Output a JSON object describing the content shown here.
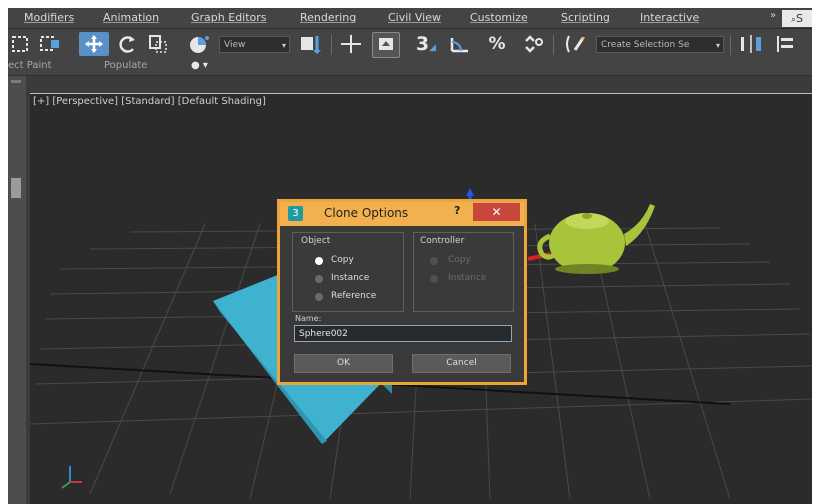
{
  "menu": {
    "items": [
      "Modifiers",
      "Animation",
      "Graph Editors",
      "Rendering",
      "Civil View",
      "Customize",
      "Scripting",
      "Interactive"
    ],
    "corner_tab": "S"
  },
  "toolbar": {
    "view_combo": "View",
    "snap_label": "3",
    "selection_set_combo": "Create Selection Se"
  },
  "subbar": {
    "left_label": "ect Paint",
    "populate_label": "Populate"
  },
  "viewport": {
    "label": "[+] [Perspective] [Standard] [Default Shading]"
  },
  "dialog": {
    "title": "Clone Options",
    "help": "?",
    "close": "✕",
    "object_group": "Object",
    "object_options": [
      "Copy",
      "Instance",
      "Reference"
    ],
    "object_selected": "Copy",
    "controller_group": "Controller",
    "controller_options": [
      "Copy",
      "Instance"
    ],
    "name_label": "Name:",
    "name_value": "Sphere002",
    "ok": "OK",
    "cancel": "Cancel"
  },
  "colors": {
    "dialog_border": "#eca53a",
    "close_button": "#c9463d",
    "box": "#3fb2cf",
    "teapot": "#a8c43a",
    "active_tool": "#5a90c8"
  }
}
